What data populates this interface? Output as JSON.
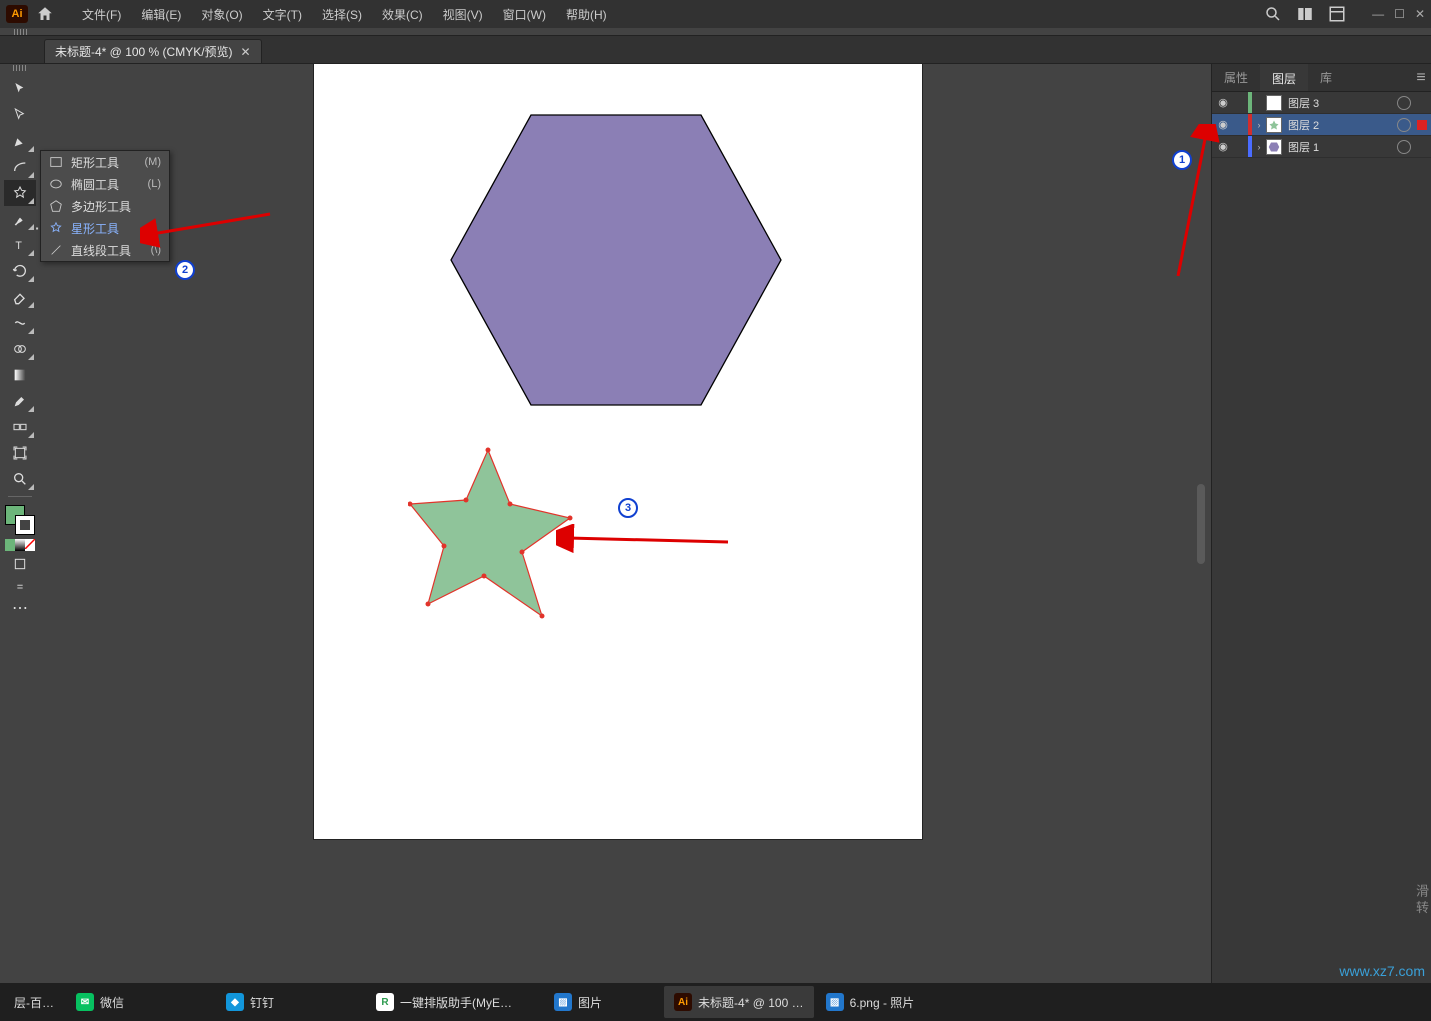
{
  "menubar": {
    "items": [
      "文件(F)",
      "编辑(E)",
      "对象(O)",
      "文字(T)",
      "选择(S)",
      "效果(C)",
      "视图(V)",
      "窗口(W)",
      "帮助(H)"
    ]
  },
  "document": {
    "tab_title": "未标题-4* @ 100 % (CMYK/预览)"
  },
  "tool_flyout": {
    "items": [
      {
        "label": "矩形工具",
        "shortcut": "(M)"
      },
      {
        "label": "椭圆工具",
        "shortcut": "(L)"
      },
      {
        "label": "多边形工具",
        "shortcut": ""
      },
      {
        "label": "星形工具",
        "shortcut": ""
      },
      {
        "label": "直线段工具",
        "shortcut": "(\\)"
      }
    ]
  },
  "panels": {
    "tabs": [
      "属性",
      "图层",
      "库"
    ],
    "layers": [
      {
        "name": "图层 3",
        "color": "#6cb57a",
        "thumb": "blank"
      },
      {
        "name": "图层 2",
        "color": "#d22d2d",
        "thumb": "star",
        "selected": true
      },
      {
        "name": "图层 1",
        "color": "#4a6cff",
        "thumb": "hex"
      }
    ]
  },
  "taskbar": {
    "items": [
      {
        "label": "层-百…",
        "color": "#3a7bd5"
      },
      {
        "label": "微信",
        "color": "#2e2e2e"
      },
      {
        "label": "钉钉",
        "color": "#1296db"
      },
      {
        "label": "一键排版助手(MyE…",
        "color": "#2e9b4f"
      },
      {
        "label": "图片",
        "color": "#2277cc"
      },
      {
        "label": "未标题-4* @ 100 …",
        "color": "#2d0b00",
        "active": true
      },
      {
        "label": "6.png - 照片",
        "color": "#2277cc"
      }
    ]
  },
  "callouts": {
    "c1": "1",
    "c2": "2",
    "c3": "3"
  },
  "shapes": {
    "hexagon_fill": "#8b7fb5",
    "star_fill": "#8fc49a",
    "star_stroke": "#e2332a"
  },
  "watermark": "www.xz7.com",
  "side_text": "滑\n转"
}
